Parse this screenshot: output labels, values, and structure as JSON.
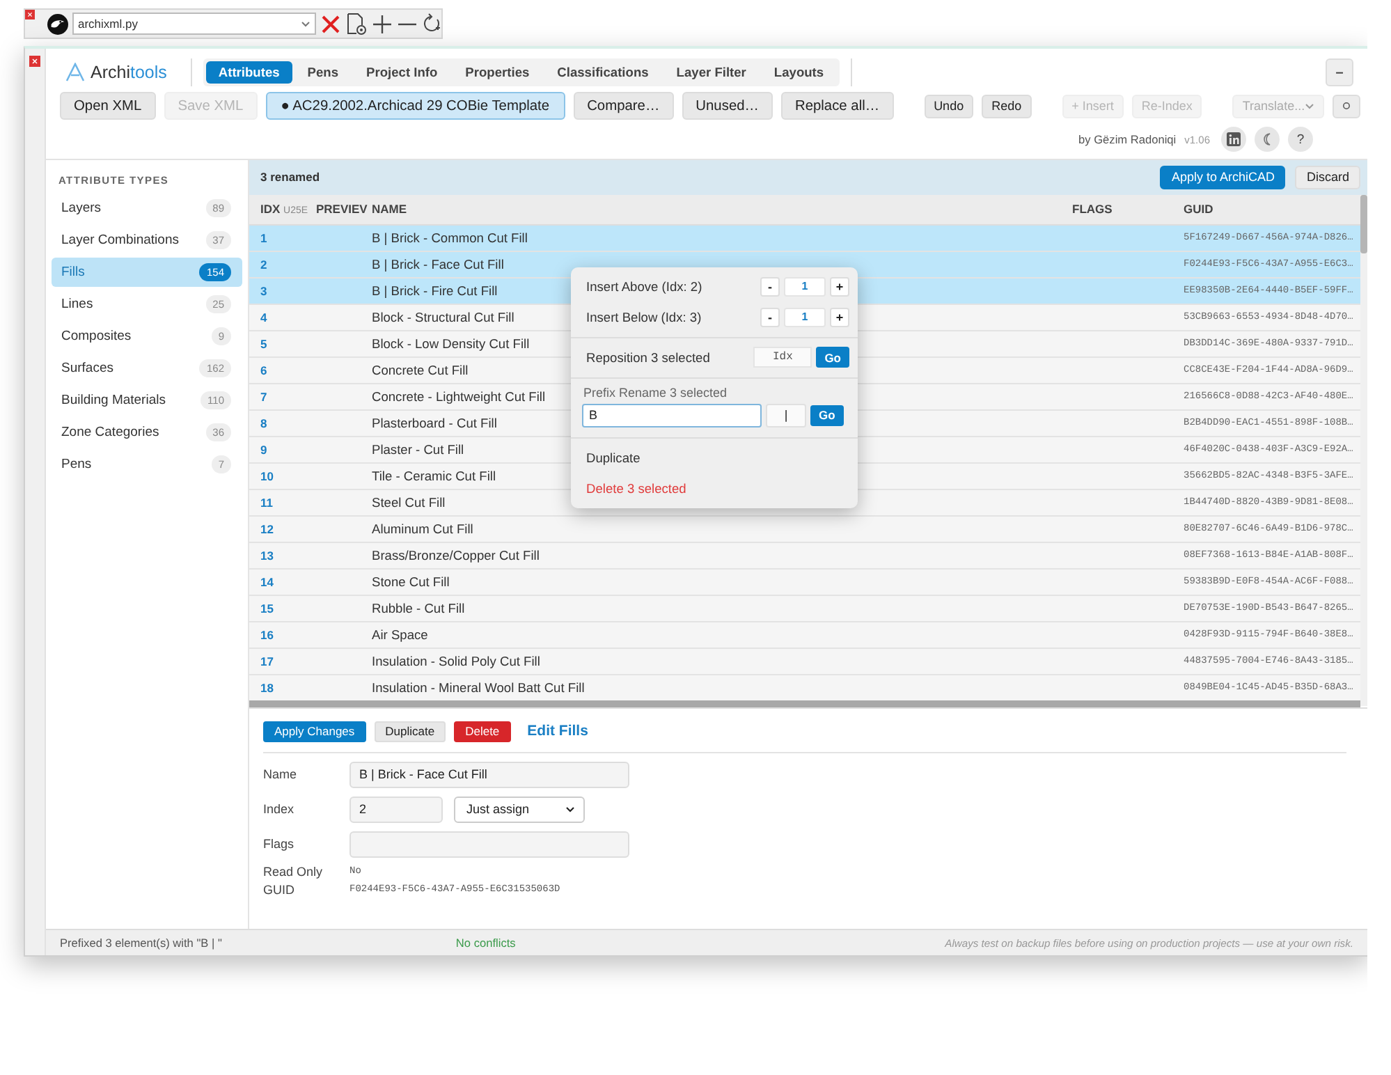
{
  "launcher": {
    "file": "archixml.py"
  },
  "header": {
    "brand_prefix": "Archi",
    "brand_suffix": "tools",
    "minimize": "–",
    "tabs": [
      {
        "label": "Attributes",
        "selected": true
      },
      {
        "label": "Pens",
        "selected": false
      },
      {
        "label": "Project Info",
        "selected": false
      },
      {
        "label": "Properties",
        "selected": false
      },
      {
        "label": "Classifications",
        "selected": false
      },
      {
        "label": "Layer Filter",
        "selected": false
      },
      {
        "label": "Layouts",
        "selected": false
      }
    ],
    "toolbar": [
      {
        "kind": "button",
        "label": "Open XML",
        "disabled": false
      },
      {
        "kind": "button",
        "label": "Save XML",
        "disabled": true
      },
      {
        "kind": "template",
        "label": "● AC29.2002.Archicad 29 COBie Template"
      },
      {
        "kind": "button",
        "label": "Compare…",
        "disabled": false
      },
      {
        "kind": "button",
        "label": "Unused…",
        "disabled": false
      },
      {
        "kind": "button",
        "label": "Replace all…",
        "disabled": false
      },
      {
        "kind": "separator"
      },
      {
        "kind": "small",
        "label": "Undo",
        "disabled": false
      },
      {
        "kind": "small",
        "label": "Redo",
        "disabled": false
      },
      {
        "kind": "separator"
      },
      {
        "kind": "small",
        "label": "+ Insert",
        "disabled": true
      },
      {
        "kind": "small",
        "label": "Re-Index",
        "disabled": true
      },
      {
        "kind": "separator"
      },
      {
        "kind": "select",
        "label": "Translate...",
        "disabled": true
      },
      {
        "kind": "gear"
      }
    ],
    "byline": "by Gëzim Radoniqi",
    "version": "v1.06",
    "help": "?"
  },
  "sidebar": {
    "heading": "ATTRIBUTE TYPES",
    "items": [
      {
        "label": "Layers",
        "count": "89",
        "selected": false
      },
      {
        "label": "Layer Combinations",
        "count": "37",
        "selected": false
      },
      {
        "label": "Fills",
        "count": "154",
        "selected": true
      },
      {
        "label": "Lines",
        "count": "25",
        "selected": false
      },
      {
        "label": "Composites",
        "count": "9",
        "selected": false
      },
      {
        "label": "Surfaces",
        "count": "162",
        "selected": false
      },
      {
        "label": "Building Materials",
        "count": "110",
        "selected": false
      },
      {
        "label": "Zone Categories",
        "count": "36",
        "selected": false
      },
      {
        "label": "Pens",
        "count": "7",
        "selected": false
      }
    ]
  },
  "table": {
    "banner": "3 renamed",
    "apply": "Apply to ArchiCAD",
    "discard": "Discard",
    "columns": [
      {
        "label": "IDX",
        "sub": "U25E"
      },
      {
        "label": "PREVIEV"
      },
      {
        "label": "NAME"
      },
      {
        "label": "FLAGS"
      },
      {
        "label": "GUID"
      }
    ],
    "rows": [
      {
        "idx": "1",
        "name": "B | Brick - Common Cut Fill",
        "guid": "5F167249-D667-456A-974A-D826…",
        "selected": true
      },
      {
        "idx": "2",
        "name": "B | Brick - Face Cut Fill",
        "guid": "F0244E93-F5C6-43A7-A955-E6C3…",
        "selected": true
      },
      {
        "idx": "3",
        "name": "B | Brick - Fire Cut Fill",
        "guid": "EE98350B-2E64-4440-B5EF-59FF…",
        "selected": true
      },
      {
        "idx": "4",
        "name": "Block - Structural Cut Fill",
        "guid": "53CB9663-6553-4934-8D48-4D70…",
        "selected": false
      },
      {
        "idx": "5",
        "name": "Block - Low Density Cut Fill",
        "guid": "DB3DD14C-369E-480A-9337-791D…",
        "selected": false
      },
      {
        "idx": "6",
        "name": "Concrete Cut Fill",
        "guid": "CC8CE43E-F204-1F44-AD8A-96D9…",
        "selected": false
      },
      {
        "idx": "7",
        "name": "Concrete - Lightweight Cut Fill",
        "guid": "216566C8-0D88-42C3-AF40-480E…",
        "selected": false
      },
      {
        "idx": "8",
        "name": "Plasterboard - Cut Fill",
        "guid": "B2B4DD90-EAC1-4551-898F-108B…",
        "selected": false
      },
      {
        "idx": "9",
        "name": "Plaster - Cut Fill",
        "guid": "46F4020C-0438-403F-A3C9-E92A…",
        "selected": false
      },
      {
        "idx": "10",
        "name": "Tile - Ceramic Cut Fill",
        "guid": "35662BD5-82AC-4348-B3F5-3AFE…",
        "selected": false
      },
      {
        "idx": "11",
        "name": "Steel Cut Fill",
        "guid": "1B44740D-8820-43B9-9D81-8E08…",
        "selected": false
      },
      {
        "idx": "12",
        "name": "Aluminum Cut Fill",
        "guid": "80E82707-6C46-6A49-B1D6-978C…",
        "selected": false
      },
      {
        "idx": "13",
        "name": "Brass/Bronze/Copper Cut Fill",
        "guid": "08EF7368-1613-B84E-A1AB-808F…",
        "selected": false
      },
      {
        "idx": "14",
        "name": "Stone Cut Fill",
        "guid": "59383B9D-E0F8-454A-AC6F-F088…",
        "selected": false
      },
      {
        "idx": "15",
        "name": "Rubble - Cut Fill",
        "guid": "DE70753E-190D-B543-B647-8265…",
        "selected": false
      },
      {
        "idx": "16",
        "name": "Air Space",
        "guid": "0428F93D-9115-794F-B640-38E8…",
        "selected": false
      },
      {
        "idx": "17",
        "name": "Insulation - Solid Poly Cut Fill",
        "guid": "44837595-7004-E746-8A43-3185…",
        "selected": false
      },
      {
        "idx": "18",
        "name": "Insulation - Mineral Wool Batt Cut Fill",
        "guid": "0849BE04-1C45-AD45-B35D-68A3…",
        "selected": false
      }
    ]
  },
  "popup": {
    "insert_above": {
      "label": "Insert Above (Idx: 2)",
      "value": "1"
    },
    "insert_below": {
      "label": "Insert Below (Idx: 3)",
      "value": "1"
    },
    "minus": "-",
    "plus": "+",
    "reposition": {
      "label": "Reposition 3 selected",
      "placeholder": "Idx",
      "go": "Go"
    },
    "prefix": {
      "label": "Prefix Rename 3 selected",
      "value": "B",
      "separator": "|",
      "go": "Go"
    },
    "duplicate": "Duplicate",
    "delete": "Delete 3 selected"
  },
  "editor": {
    "buttons": [
      {
        "kind": "primary",
        "label": "Apply Changes"
      },
      {
        "kind": "plain",
        "label": "Duplicate"
      },
      {
        "kind": "danger",
        "label": "Delete"
      }
    ],
    "title": "Edit Fills",
    "name": {
      "label": "Name",
      "value": "B | Brick - Face Cut Fill"
    },
    "index": {
      "label": "Index",
      "value": "2",
      "mode": "Just assign"
    },
    "flags": {
      "label": "Flags"
    },
    "read_only": {
      "label": "Read Only",
      "value": "No"
    },
    "guid": {
      "label": "GUID",
      "value": "F0244E93-F5C6-43A7-A955-E6C31535063D"
    }
  },
  "status_bar": {
    "message": "Prefixed 3 element(s) with \"B | \"",
    "conflicts": "No conflicts",
    "disclaimer": "Always test on backup files before using on production projects — use at your own risk."
  }
}
